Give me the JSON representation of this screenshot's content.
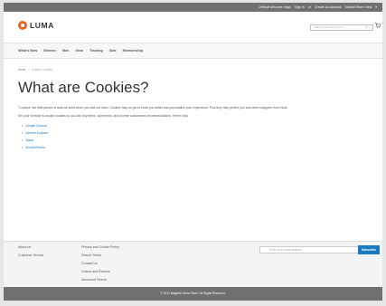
{
  "top_links": [
    "Default welcome msg!",
    "Sign In",
    "or",
    "Create an Account",
    "Default Store View"
  ],
  "brand": {
    "name": "LUMA",
    "color": "#f26322"
  },
  "search": {
    "placeholder": "Search entire store here..."
  },
  "nav": [
    "What's New",
    "Women",
    "Men",
    "Gear",
    "Training",
    "Sale",
    "Membership"
  ],
  "breadcrumb": {
    "home": "Home",
    "current": "Enable Cookies"
  },
  "page_title": "What are Cookies?",
  "intro": "\"Cookies\" are little pieces of data we send when you visit our store. Cookies help us get to know you better and personalize your experience. Plus they help protect you and other shoppers from fraud.",
  "instruction": "Set your browser to accept cookies so you can buy items, save items, and receive customized recommendations. Here's how:",
  "browsers": [
    "Google Chrome",
    "Internet Explorer",
    "Safari",
    "Mozilla/Firefox"
  ],
  "footer": {
    "col1": [
      "About us",
      "Customer Service"
    ],
    "col2": [
      "Privacy and Cookie Policy",
      "Search Terms",
      "Contact Us",
      "Orders and Returns",
      "Advanced Search"
    ],
    "newsletter_placeholder": "Enter your email address",
    "subscribe_label": "Subscribe"
  },
  "copyright": "© 2013 Magento Demo Store. All Rights Reserved.",
  "colors": {
    "accent": "#1979c3",
    "topbar": "#6e716e"
  }
}
